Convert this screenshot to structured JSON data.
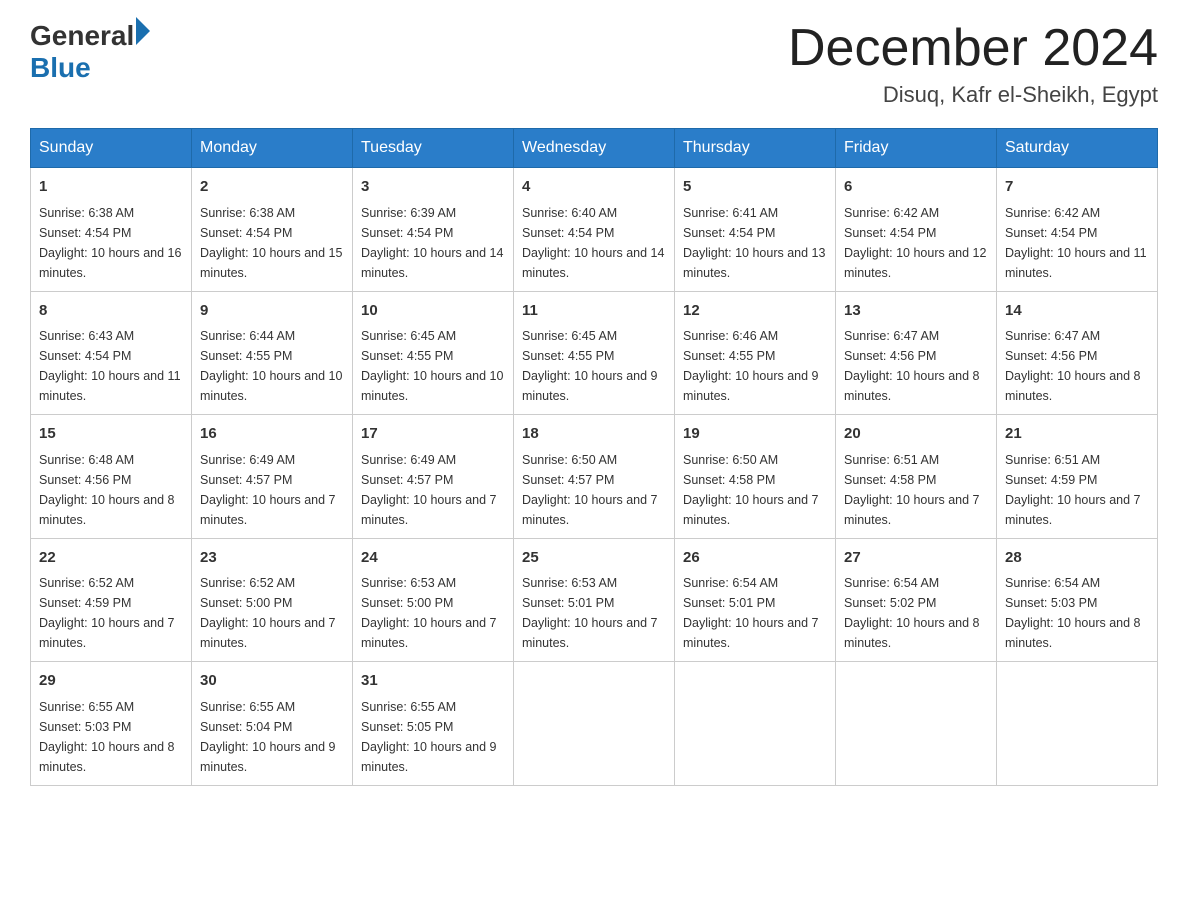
{
  "header": {
    "logo_general": "General",
    "logo_blue": "Blue",
    "month_title": "December 2024",
    "location": "Disuq, Kafr el-Sheikh, Egypt"
  },
  "days_of_week": [
    "Sunday",
    "Monday",
    "Tuesday",
    "Wednesday",
    "Thursday",
    "Friday",
    "Saturday"
  ],
  "weeks": [
    [
      {
        "day": "1",
        "sunrise": "6:38 AM",
        "sunset": "4:54 PM",
        "daylight": "10 hours and 16 minutes."
      },
      {
        "day": "2",
        "sunrise": "6:38 AM",
        "sunset": "4:54 PM",
        "daylight": "10 hours and 15 minutes."
      },
      {
        "day": "3",
        "sunrise": "6:39 AM",
        "sunset": "4:54 PM",
        "daylight": "10 hours and 14 minutes."
      },
      {
        "day": "4",
        "sunrise": "6:40 AM",
        "sunset": "4:54 PM",
        "daylight": "10 hours and 14 minutes."
      },
      {
        "day": "5",
        "sunrise": "6:41 AM",
        "sunset": "4:54 PM",
        "daylight": "10 hours and 13 minutes."
      },
      {
        "day": "6",
        "sunrise": "6:42 AM",
        "sunset": "4:54 PM",
        "daylight": "10 hours and 12 minutes."
      },
      {
        "day": "7",
        "sunrise": "6:42 AM",
        "sunset": "4:54 PM",
        "daylight": "10 hours and 11 minutes."
      }
    ],
    [
      {
        "day": "8",
        "sunrise": "6:43 AM",
        "sunset": "4:54 PM",
        "daylight": "10 hours and 11 minutes."
      },
      {
        "day": "9",
        "sunrise": "6:44 AM",
        "sunset": "4:55 PM",
        "daylight": "10 hours and 10 minutes."
      },
      {
        "day": "10",
        "sunrise": "6:45 AM",
        "sunset": "4:55 PM",
        "daylight": "10 hours and 10 minutes."
      },
      {
        "day": "11",
        "sunrise": "6:45 AM",
        "sunset": "4:55 PM",
        "daylight": "10 hours and 9 minutes."
      },
      {
        "day": "12",
        "sunrise": "6:46 AM",
        "sunset": "4:55 PM",
        "daylight": "10 hours and 9 minutes."
      },
      {
        "day": "13",
        "sunrise": "6:47 AM",
        "sunset": "4:56 PM",
        "daylight": "10 hours and 8 minutes."
      },
      {
        "day": "14",
        "sunrise": "6:47 AM",
        "sunset": "4:56 PM",
        "daylight": "10 hours and 8 minutes."
      }
    ],
    [
      {
        "day": "15",
        "sunrise": "6:48 AM",
        "sunset": "4:56 PM",
        "daylight": "10 hours and 8 minutes."
      },
      {
        "day": "16",
        "sunrise": "6:49 AM",
        "sunset": "4:57 PM",
        "daylight": "10 hours and 7 minutes."
      },
      {
        "day": "17",
        "sunrise": "6:49 AM",
        "sunset": "4:57 PM",
        "daylight": "10 hours and 7 minutes."
      },
      {
        "day": "18",
        "sunrise": "6:50 AM",
        "sunset": "4:57 PM",
        "daylight": "10 hours and 7 minutes."
      },
      {
        "day": "19",
        "sunrise": "6:50 AM",
        "sunset": "4:58 PM",
        "daylight": "10 hours and 7 minutes."
      },
      {
        "day": "20",
        "sunrise": "6:51 AM",
        "sunset": "4:58 PM",
        "daylight": "10 hours and 7 minutes."
      },
      {
        "day": "21",
        "sunrise": "6:51 AM",
        "sunset": "4:59 PM",
        "daylight": "10 hours and 7 minutes."
      }
    ],
    [
      {
        "day": "22",
        "sunrise": "6:52 AM",
        "sunset": "4:59 PM",
        "daylight": "10 hours and 7 minutes."
      },
      {
        "day": "23",
        "sunrise": "6:52 AM",
        "sunset": "5:00 PM",
        "daylight": "10 hours and 7 minutes."
      },
      {
        "day": "24",
        "sunrise": "6:53 AM",
        "sunset": "5:00 PM",
        "daylight": "10 hours and 7 minutes."
      },
      {
        "day": "25",
        "sunrise": "6:53 AM",
        "sunset": "5:01 PM",
        "daylight": "10 hours and 7 minutes."
      },
      {
        "day": "26",
        "sunrise": "6:54 AM",
        "sunset": "5:01 PM",
        "daylight": "10 hours and 7 minutes."
      },
      {
        "day": "27",
        "sunrise": "6:54 AM",
        "sunset": "5:02 PM",
        "daylight": "10 hours and 8 minutes."
      },
      {
        "day": "28",
        "sunrise": "6:54 AM",
        "sunset": "5:03 PM",
        "daylight": "10 hours and 8 minutes."
      }
    ],
    [
      {
        "day": "29",
        "sunrise": "6:55 AM",
        "sunset": "5:03 PM",
        "daylight": "10 hours and 8 minutes."
      },
      {
        "day": "30",
        "sunrise": "6:55 AM",
        "sunset": "5:04 PM",
        "daylight": "10 hours and 9 minutes."
      },
      {
        "day": "31",
        "sunrise": "6:55 AM",
        "sunset": "5:05 PM",
        "daylight": "10 hours and 9 minutes."
      },
      null,
      null,
      null,
      null
    ]
  ],
  "labels": {
    "sunrise": "Sunrise:",
    "sunset": "Sunset:",
    "daylight": "Daylight:"
  }
}
